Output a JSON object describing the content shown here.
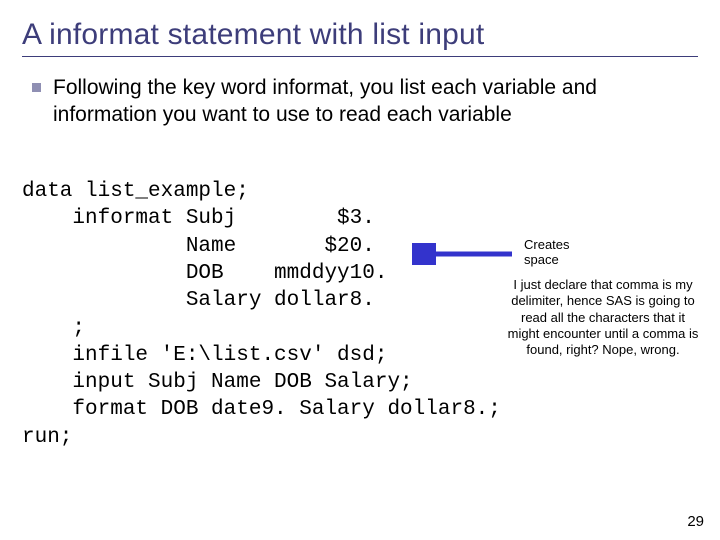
{
  "title": "A informat statement with list input",
  "bullet": "Following the key word informat, you list each variable and information you want to use to read each variable",
  "code": {
    "l1": "data list_example;",
    "l2": "    informat Subj        $3.",
    "l3": "             Name       $20.",
    "l4": "             DOB    mmddyy10.",
    "l5": "             Salary dollar8.",
    "l6": "    ;",
    "l7": "    infile 'E:\\list.csv' dsd;",
    "l8": "    input Subj Name DOB Salary;",
    "l9": "    format DOB date9. Salary dollar8.;",
    "l10": "run;"
  },
  "annotation": {
    "creates_line1": "Creates",
    "creates_line2": "space",
    "sidenote": "I just declare that comma is my delimiter, hence SAS is going to read all the characters that it might encounter until a comma is found, right? Nope, wrong."
  },
  "page_number": "29",
  "colors": {
    "accent": "#3d3d7a",
    "arrow": "#3333cc"
  }
}
